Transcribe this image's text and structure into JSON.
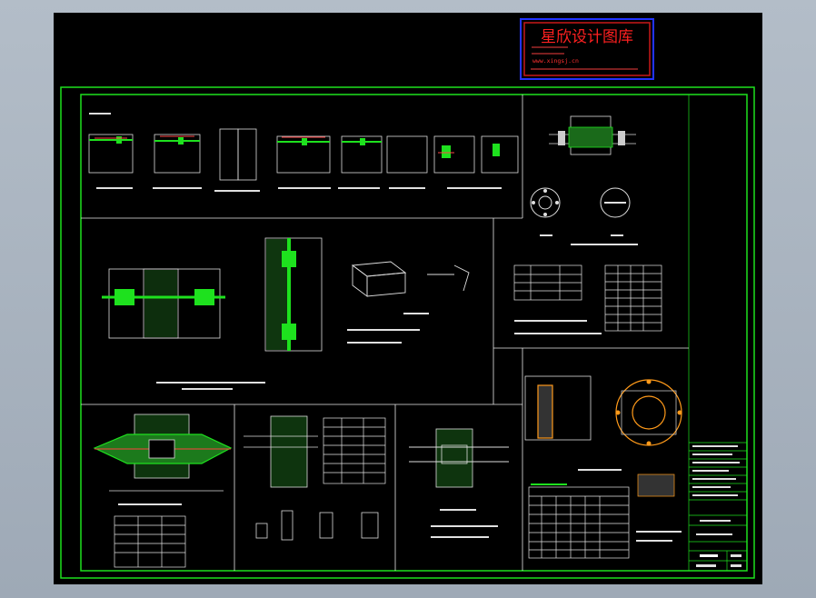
{
  "watermark": {
    "title": "星欣设计图库",
    "website": "www.xingsj.cn"
  }
}
